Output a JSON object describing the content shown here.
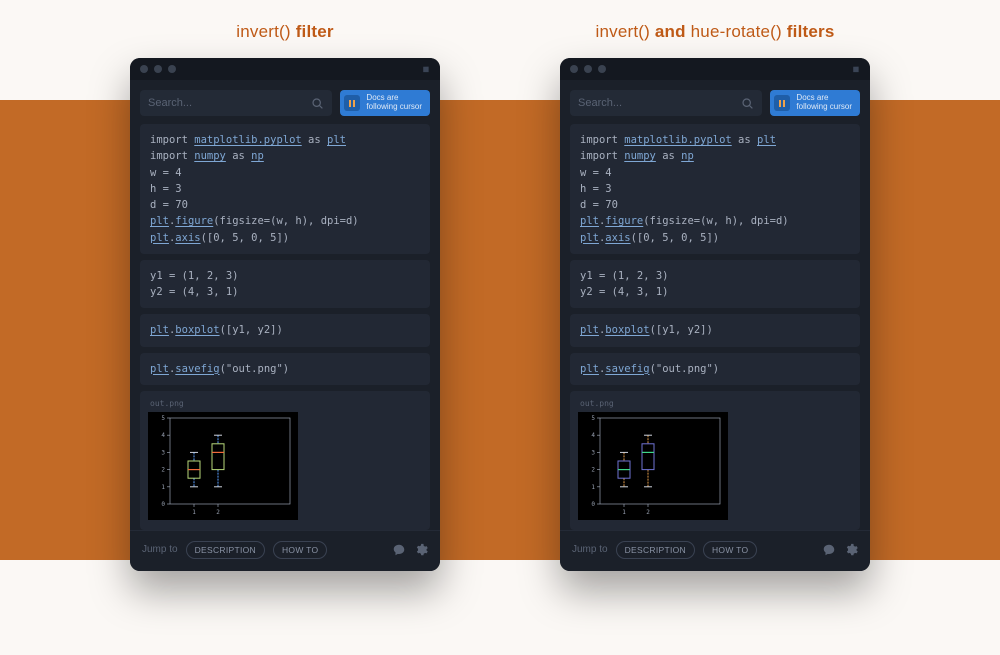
{
  "captions": {
    "left_prefix": "invert()",
    "left_suffix": " filter",
    "right_prefix": "invert()",
    "right_mid": " and ",
    "right_fn2": "hue-rotate()",
    "right_suffix": " filters"
  },
  "toolbar": {
    "search_placeholder": "Search...",
    "docs_line1": "Docs are",
    "docs_line2": "following cursor"
  },
  "code": {
    "cell1_line1_pre": "import ",
    "cell1_line1_mpl": "matplotlib.pyplot",
    "cell1_line1_as": " as ",
    "cell1_line1_alias": "plt",
    "cell1_line2_pre": "import ",
    "cell1_line2_np": "numpy",
    "cell1_line2_as": " as ",
    "cell1_line2_alias": "np",
    "cell1_line3": "w = 4",
    "cell1_line4": "h = 3",
    "cell1_line5": "d = 70",
    "cell1_line6_plt": "plt",
    "cell1_line6_dot": ".",
    "cell1_line6_fn": "figure",
    "cell1_line6_args": "(figsize=(w, h), dpi=d)",
    "cell1_line7_plt": "plt",
    "cell1_line7_dot": ".",
    "cell1_line7_fn": "axis",
    "cell1_line7_args": "([0, 5, 0, 5])",
    "cell2_line1": "y1 = (1, 2, 3)",
    "cell2_line2": "y2 = (4, 3, 1)",
    "cell3_plt": "plt",
    "cell3_dot": ".",
    "cell3_fn": "boxplot",
    "cell3_args": "([y1, y2])",
    "cell4_plt": "plt",
    "cell4_dot": ".",
    "cell4_fn": "savefig",
    "cell4_args": "(\"out.png\")",
    "out_label": "out.png"
  },
  "footer": {
    "jump": "Jump to",
    "btn1": "DESCRIPTION",
    "btn2": "HOW TO"
  },
  "chart_data": [
    {
      "type": "boxplot",
      "variant": "invert",
      "xlim": [
        0,
        5
      ],
      "ylim": [
        0,
        5
      ],
      "xticks": [
        1,
        2
      ],
      "yticks": [
        0,
        1,
        2,
        3,
        4,
        5
      ],
      "series": [
        {
          "x": 1,
          "values": [
            1,
            2,
            3
          ],
          "min": 1,
          "q1": 1.5,
          "median": 2,
          "q3": 2.5,
          "max": 3,
          "colors": {
            "box": "#b7d97a",
            "median": "#f06a3a",
            "whisker": "#5aa0ff",
            "cap": "#cfd4de"
          }
        },
        {
          "x": 2,
          "values": [
            4,
            3,
            1
          ],
          "min": 1,
          "q1": 2.0,
          "median": 3,
          "q3": 3.5,
          "max": 4,
          "colors": {
            "box": "#b7d97a",
            "median": "#f06a3a",
            "whisker": "#5aa0ff",
            "cap": "#cfd4de"
          }
        }
      ]
    },
    {
      "type": "boxplot",
      "variant": "invert+hue-rotate",
      "xlim": [
        0,
        5
      ],
      "ylim": [
        0,
        5
      ],
      "xticks": [
        1,
        2
      ],
      "yticks": [
        0,
        1,
        2,
        3,
        4,
        5
      ],
      "series": [
        {
          "x": 1,
          "values": [
            1,
            2,
            3
          ],
          "min": 1,
          "q1": 1.5,
          "median": 2,
          "q3": 2.5,
          "max": 3,
          "colors": {
            "box": "#6f73d4",
            "median": "#3fd68a",
            "whisker": "#e09a4a",
            "cap": "#cfd4de"
          }
        },
        {
          "x": 2,
          "values": [
            4,
            3,
            1
          ],
          "min": 1,
          "q1": 2.0,
          "median": 3,
          "q3": 3.5,
          "max": 4,
          "colors": {
            "box": "#6f73d4",
            "median": "#3fd68a",
            "whisker": "#e09a4a",
            "cap": "#cfd4de"
          }
        }
      ]
    }
  ]
}
